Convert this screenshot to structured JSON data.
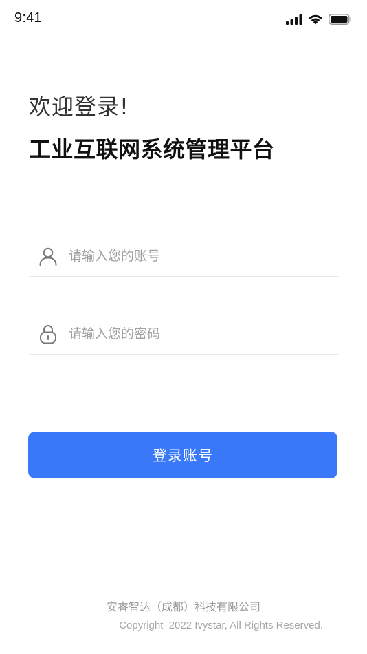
{
  "status_bar": {
    "time": "9:41",
    "icons": [
      "cellular-signal-icon",
      "wifi-icon",
      "battery-icon"
    ]
  },
  "header": {
    "welcome": "欢迎登录!",
    "title": "工业互联网系统管理平台"
  },
  "form": {
    "account": {
      "icon": "user-icon",
      "value": "",
      "placeholder": "请输入您的账号"
    },
    "password": {
      "icon": "lock-icon",
      "value": "",
      "placeholder": "请输入您的密码"
    }
  },
  "login_button": {
    "label": "登录账号"
  },
  "footer": {
    "company": "安睿智达（成都）科技有限公司",
    "copyright": "Copyright  2022 Ivystar, All Rights Reserved."
  },
  "colors": {
    "primary": "#3978f8",
    "text_dark": "#111111",
    "placeholder": "#a0a0a0",
    "footer_text": "#9a9a9a",
    "divider": "#e8e8e8"
  }
}
